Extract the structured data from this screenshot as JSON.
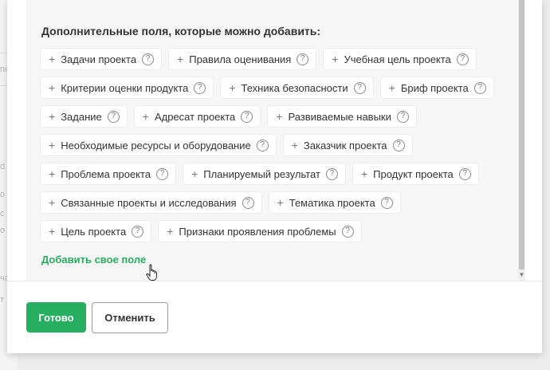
{
  "background": {
    "fragments": [
      "пе",
      "d",
      "о",
      "с",
      "о",
      "ча",
      "т"
    ]
  },
  "modal": {
    "section_title": "Дополнительные поля, которые можно добавить:",
    "chip_rows": [
      [
        {
          "label": "Задачи проекта"
        },
        {
          "label": "Правила оценивания"
        },
        {
          "label": "Учебная цель проекта"
        }
      ],
      [
        {
          "label": "Критерии оценки продукта"
        },
        {
          "label": "Техника безопасности"
        },
        {
          "label": "Бриф проекта"
        }
      ],
      [
        {
          "label": "Задание"
        },
        {
          "label": "Адресат проекта"
        },
        {
          "label": "Развиваемые навыки"
        }
      ],
      [
        {
          "label": "Необходимые ресурсы и оборудование"
        },
        {
          "label": "Заказчик проекта"
        }
      ],
      [
        {
          "label": "Проблема проекта"
        },
        {
          "label": "Планируемый результат"
        },
        {
          "label": "Продукт проекта"
        }
      ],
      [
        {
          "label": "Связанные проекты и исследования"
        },
        {
          "label": "Тематика проекта"
        }
      ],
      [
        {
          "label": "Цель проекта"
        },
        {
          "label": "Признаки проявления проблемы"
        }
      ]
    ],
    "plus_glyph": "+",
    "help_glyph": "?",
    "add_own_field": "Добавить свое поле",
    "done_label": "Готово",
    "cancel_label": "Отменить"
  },
  "colors": {
    "accent": "#27ae60",
    "chip_bg": "#ffffff",
    "panel_bg": "#f6f6f6"
  }
}
